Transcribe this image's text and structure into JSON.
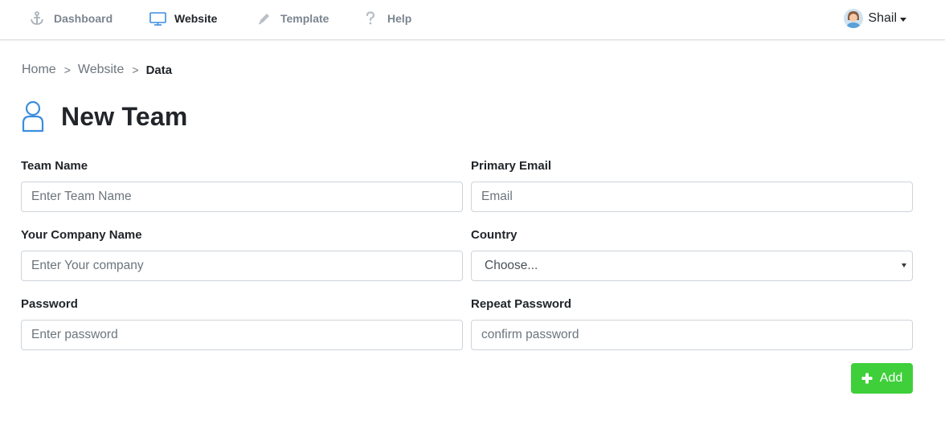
{
  "nav": {
    "items": [
      {
        "label": "Dashboard",
        "icon": "anchor-icon",
        "active": false
      },
      {
        "label": "Website",
        "icon": "monitor-icon",
        "active": true
      },
      {
        "label": "Template",
        "icon": "pencil-icon",
        "active": false
      },
      {
        "label": "Help",
        "icon": "question-icon",
        "active": false
      }
    ],
    "user": {
      "name": "Shail",
      "icon": "avatar"
    }
  },
  "breadcrumb": {
    "items": [
      "Home",
      "Website",
      "Data"
    ],
    "separator": ">"
  },
  "page": {
    "title": "New Team",
    "title_icon": "user-outline-icon"
  },
  "form": {
    "team_name": {
      "label": "Team Name",
      "placeholder": "Enter Team Name",
      "value": ""
    },
    "primary_email": {
      "label": "Primary Email",
      "placeholder": "Email",
      "value": ""
    },
    "company_name": {
      "label": "Your Company Name",
      "placeholder": "Enter Your company",
      "value": ""
    },
    "country": {
      "label": "Country",
      "selected": "Choose..."
    },
    "password": {
      "label": "Password",
      "placeholder": "Enter password",
      "value": ""
    },
    "repeat_password": {
      "label": "Repeat Password",
      "placeholder": "confirm password",
      "value": ""
    },
    "submit": {
      "label": "Add",
      "icon": "plus-icon"
    }
  },
  "colors": {
    "accent_blue": "#3b8ee0",
    "add_button": "#3ecf3a",
    "nav_inactive": "#7b8590",
    "border": "#ced4da"
  }
}
